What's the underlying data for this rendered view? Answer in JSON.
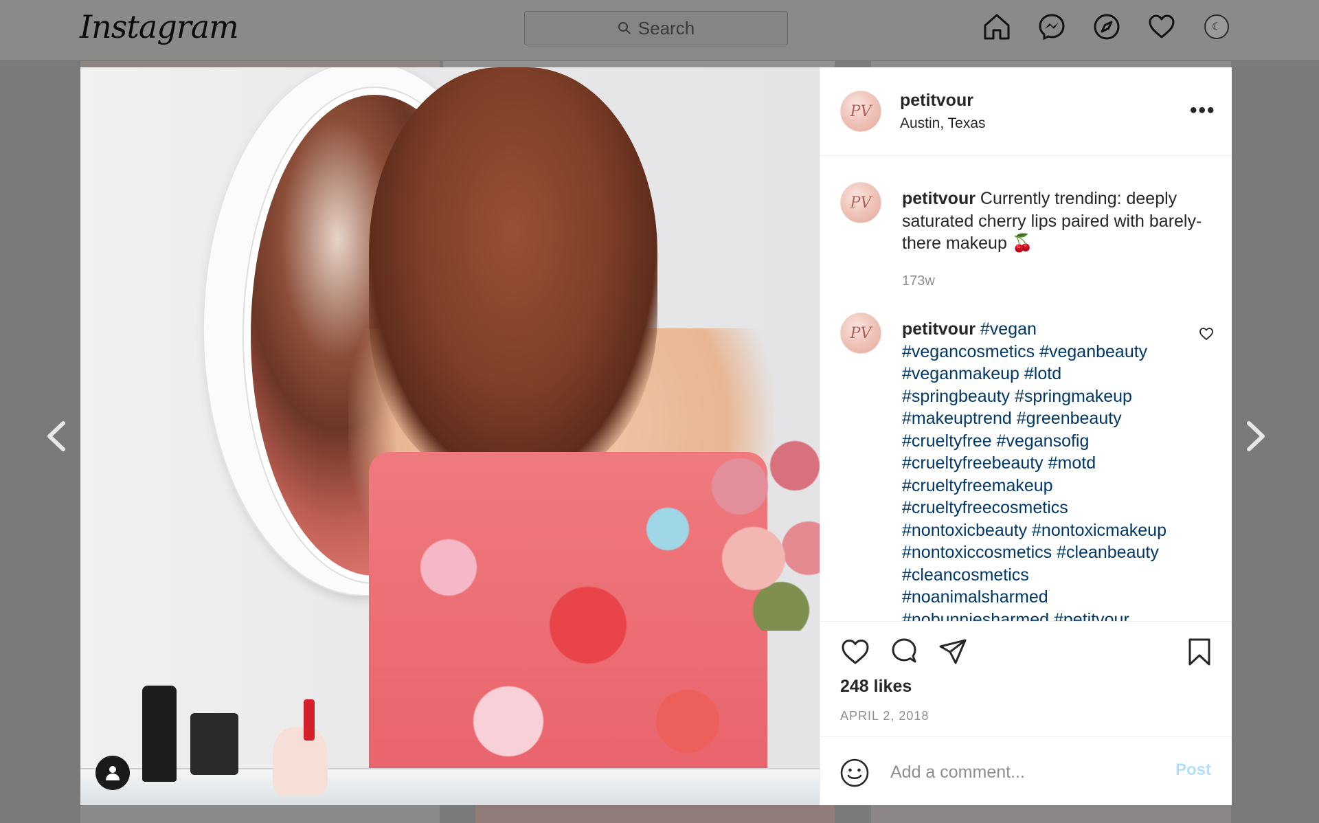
{
  "nav": {
    "logo": "Instagram",
    "search_placeholder": "Search",
    "icons": [
      "home-icon",
      "messenger-icon",
      "explore-icon",
      "activity-heart-icon",
      "profile-avatar"
    ]
  },
  "post": {
    "username": "petitvour",
    "location": "Austin, Texas",
    "avatar_monogram": "PV",
    "caption": {
      "username": "petitvour",
      "text": "Currently trending: deeply saturated cherry lips paired with barely-there makeup 🍒",
      "time": "173w"
    },
    "comment": {
      "username": "petitvour",
      "hashtags": [
        "#vegan",
        "#vegancosmetics #veganbeauty",
        "#veganmakeup #lotd",
        "#springbeauty #springmakeup",
        "#makeuptrend #greenbeauty",
        "#crueltyfree #vegansofig",
        "#crueltyfreebeauty #motd",
        "#crueltyfreemakeup",
        "#crueltyfreecosmetics",
        "#nontoxicbeauty #nontoxicmakeup",
        "#nontoxiccosmetics #cleanbeauty",
        "#cleancosmetics",
        "#noanimalsharmed",
        "#nobunniesharmed #petitvour"
      ]
    },
    "likes": "248 likes",
    "date": "APRIL 2, 2018",
    "comment_placeholder": "Add a comment...",
    "post_label": "Post"
  },
  "colors": {
    "hashtag": "#00376b",
    "post_button": "#b2dffc",
    "overlay": "#7a7a7a"
  }
}
